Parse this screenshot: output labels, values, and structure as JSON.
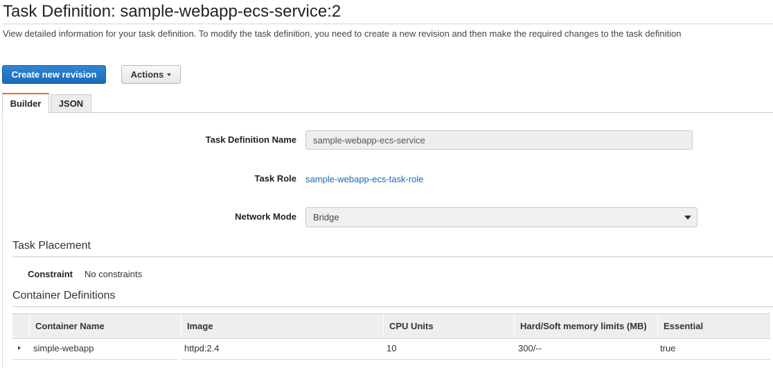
{
  "header": {
    "title": "Task Definition: sample-webapp-ecs-service:2",
    "description": "View detailed information for your task definition. To modify the task definition, you need to create a new revision and then make the required changes to the task definition"
  },
  "toolbar": {
    "create_revision_label": "Create new revision",
    "actions_label": "Actions"
  },
  "tabs": [
    {
      "label": "Builder",
      "active": true
    },
    {
      "label": "JSON",
      "active": false
    }
  ],
  "form": {
    "task_definition_name_label": "Task Definition Name",
    "task_definition_name_value": "sample-webapp-ecs-service",
    "task_role_label": "Task Role",
    "task_role_value": "sample-webapp-ecs-task-role",
    "network_mode_label": "Network Mode",
    "network_mode_value": "Bridge"
  },
  "task_placement": {
    "title": "Task Placement",
    "constraint_label": "Constraint",
    "constraint_value": "No constraints"
  },
  "container_definitions": {
    "title": "Container Definitions",
    "columns": [
      "Container Name",
      "Image",
      "CPU Units",
      "Hard/Soft memory limits (MB)",
      "Essential"
    ],
    "rows": [
      {
        "name": "simple-webapp",
        "image": "httpd:2.4",
        "cpu": "10",
        "memory": "300/--",
        "essential": "true"
      }
    ]
  },
  "colors": {
    "primary_button": "#1a6bb8",
    "link": "#1a66b5",
    "active_tab_accent": "#ec7211"
  }
}
